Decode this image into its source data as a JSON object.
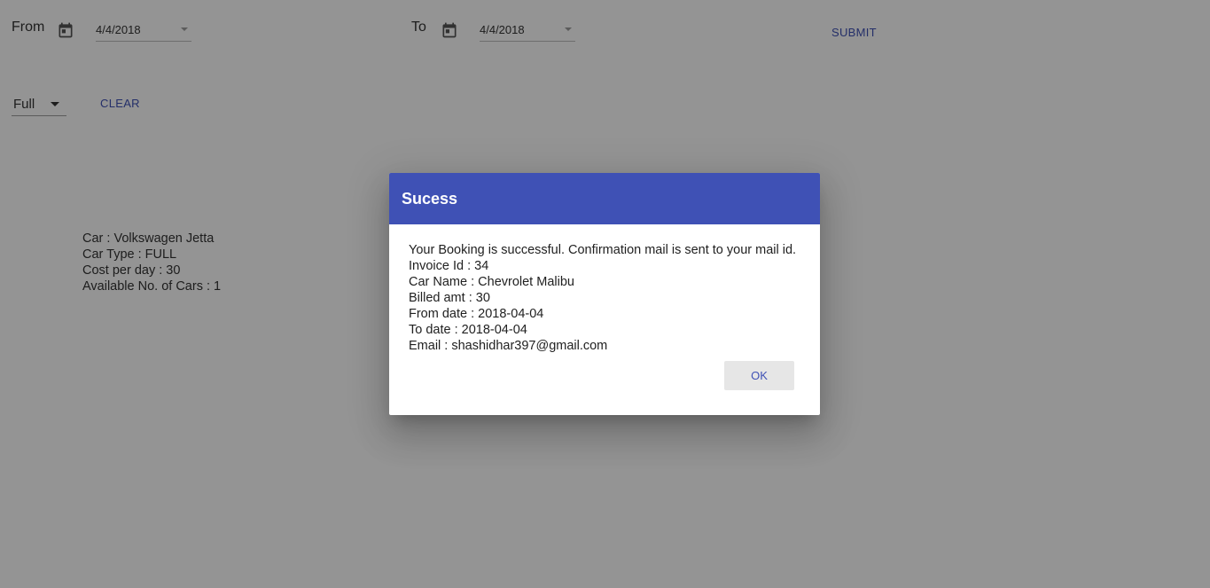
{
  "filters": {
    "from_label": "From",
    "from_value": "4/4/2018",
    "to_label": "To",
    "to_value": "4/4/2018",
    "submit_label": "SUBMIT",
    "car_type_selected": "Full",
    "clear_label": "CLEAR"
  },
  "car": {
    "name_line": "Car : Volkswagen Jetta",
    "type_line": "Car Type : FULL",
    "cost_line": "Cost per day : 30",
    "available_line": "Available No. of Cars : 1"
  },
  "dialog": {
    "title": "Sucess",
    "message": "Your Booking is successful. Confirmation mail is sent to your mail id.",
    "invoice_line": "Invoice Id : 34",
    "car_name_line": "Car Name : Chevrolet Malibu",
    "billed_line": "Billed amt : 30",
    "from_date_line": "From date : 2018-04-04",
    "to_date_line": "To date : 2018-04-04",
    "email_line": "Email : shashidhar397@gmail.com",
    "ok_label": "OK"
  },
  "colors": {
    "primary": "#3f51b5",
    "overlay": "rgba(0,0,0,0.42)"
  },
  "icons": {
    "date_picker": "calendar-icon",
    "dropdown": "caret-down-icon"
  }
}
